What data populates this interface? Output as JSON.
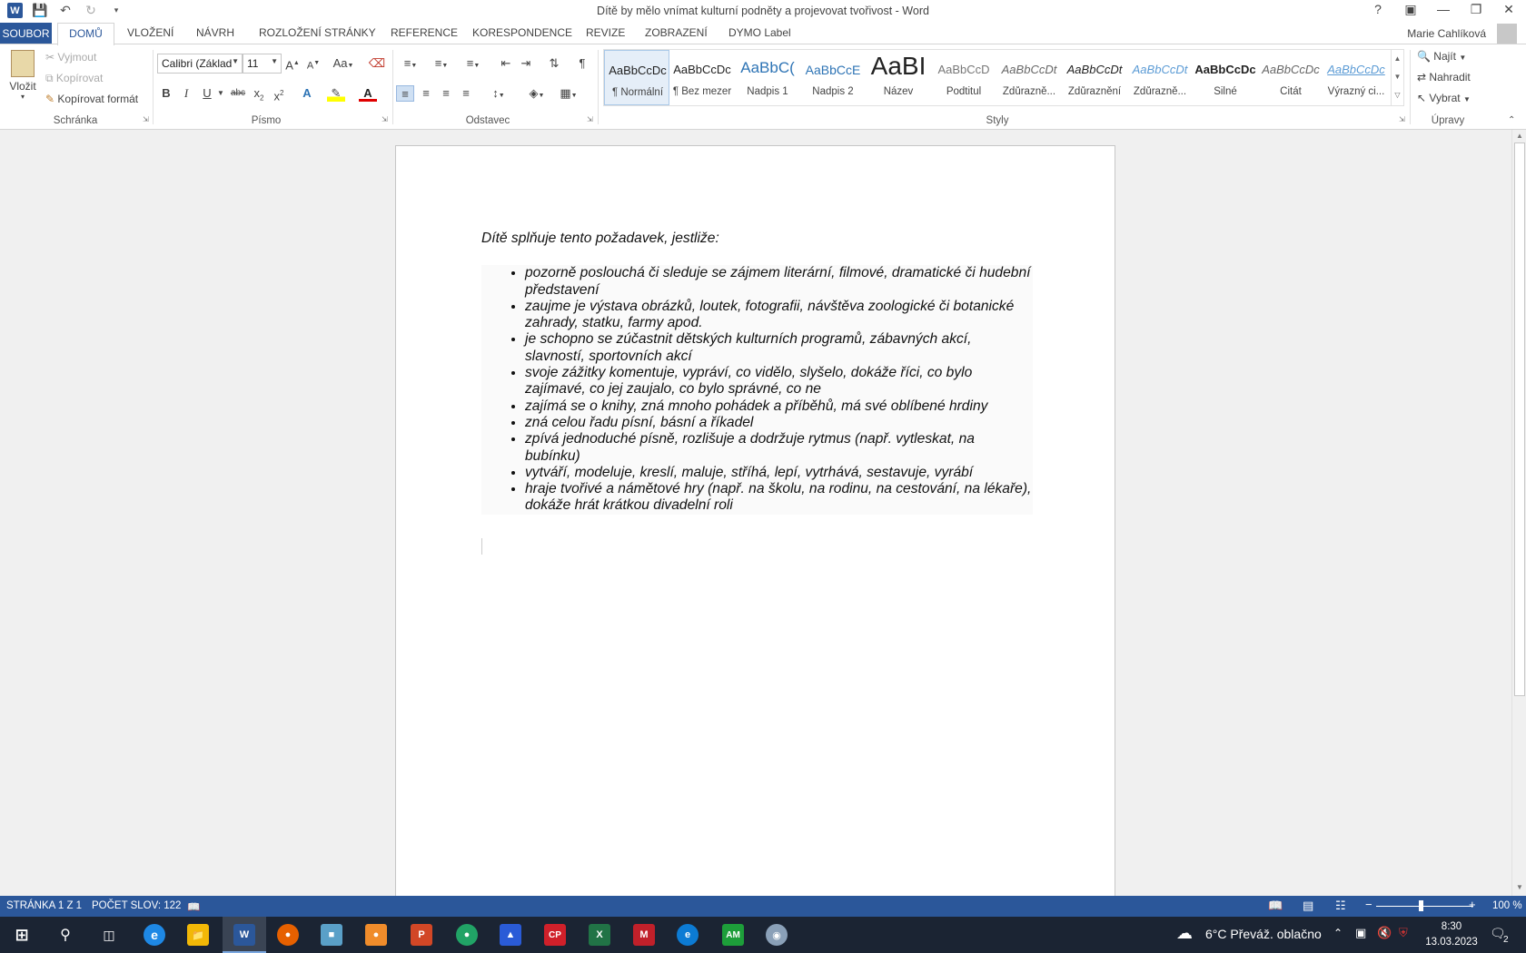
{
  "app": {
    "title": "Dítě by mělo vnímat kulturní podněty a projevovat tvořivost - Word",
    "logo_letter": "W",
    "user": "Marie Cahlíková"
  },
  "tabs": [
    "SOUBOR",
    "DOMŮ",
    "VLOŽENÍ",
    "NÁVRH",
    "ROZLOŽENÍ STRÁNKY",
    "REFERENCE",
    "KORESPONDENCE",
    "REVIZE",
    "ZOBRAZENÍ",
    "DYMO Label"
  ],
  "ribbon": {
    "clipboard": {
      "label": "Schránka",
      "paste": "Vložit",
      "cut": "Vyjmout",
      "copy": "Kopírovat",
      "format_painter": "Kopírovat formát"
    },
    "font": {
      "label": "Písmo",
      "font_name": "Calibri (Základ",
      "font_size": "11"
    },
    "paragraph": {
      "label": "Odstavec"
    },
    "styles": {
      "label": "Styly",
      "items": [
        {
          "sample": "AaBbCcDc",
          "name": "¶ Normální",
          "color": "#222222"
        },
        {
          "sample": "AaBbCcDc",
          "name": "¶ Bez mezer",
          "color": "#222222"
        },
        {
          "sample": "AaBbC(",
          "name": "Nadpis 1",
          "color": "#2e74b5"
        },
        {
          "sample": "AaBbCcE",
          "name": "Nadpis 2",
          "color": "#2e74b5"
        },
        {
          "sample": "AaBI",
          "name": "Název",
          "color": "#222222"
        },
        {
          "sample": "AaBbCcD",
          "name": "Podtitul",
          "color": "#666666"
        },
        {
          "sample": "AaBbCcDt",
          "name": "Zdůrazně...",
          "color": "#555555"
        },
        {
          "sample": "AaBbCcDt",
          "name": "Zdůraznění",
          "color": "#222222"
        },
        {
          "sample": "AaBbCcDt",
          "name": "Zdůrazně...",
          "color": "#5b9bd5"
        },
        {
          "sample": "AaBbCcDc",
          "name": "Silné",
          "color": "#111111"
        },
        {
          "sample": "AaBbCcDc",
          "name": "Citát",
          "color": "#555555"
        },
        {
          "sample": "AaBbCcDc",
          "name": "Výrazný ci...",
          "color": "#5b9bd5"
        }
      ]
    },
    "editing": {
      "label": "Úpravy",
      "find": "Najít",
      "replace": "Nahradit",
      "select": "Vybrat"
    }
  },
  "document": {
    "intro": "Dítě splňuje tento požadavek, jestliže:",
    "bullets": [
      "pozorně poslouchá či sleduje se zájmem literární, filmové, dramatické či hudební představení",
      "zaujme je výstava obrázků, loutek, fotografii, návštěva zoologické či botanické zahrady, statku, farmy apod.",
      "je schopno se zúčastnit dětských kulturních programů, zábavných akcí, slavností, sportovních akcí",
      "svoje zážitky komentuje, vypráví, co vidělo, slyšelo, dokáže říci, co bylo zajímavé, co jej zaujalo, co bylo správné, co ne",
      "zajímá se o knihy, zná mnoho pohádek a příběhů, má své oblíbené hrdiny",
      "zná celou řadu písní, básní a říkadel",
      "zpívá jednoduché písně, rozlišuje a dodržuje rytmus (např. vytleskat, na bubínku)",
      "vytváří, modeluje, kreslí, maluje, stříhá, lepí, vytrhává, sestavuje, vyrábí",
      "hraje tvořivé a námětové hry (např. na školu, na rodinu, na cestování, na lékaře), dokáže hrát krátkou divadelní roli"
    ]
  },
  "status": {
    "page": "STRÁNKA 1 Z 1",
    "words": "POČET SLOV: 122",
    "zoom": "100 %"
  },
  "taskbar": {
    "weather": "6°C  Převáž. oblačno",
    "time": "8:30",
    "date": "13.03.2023",
    "notif_count": "2"
  }
}
